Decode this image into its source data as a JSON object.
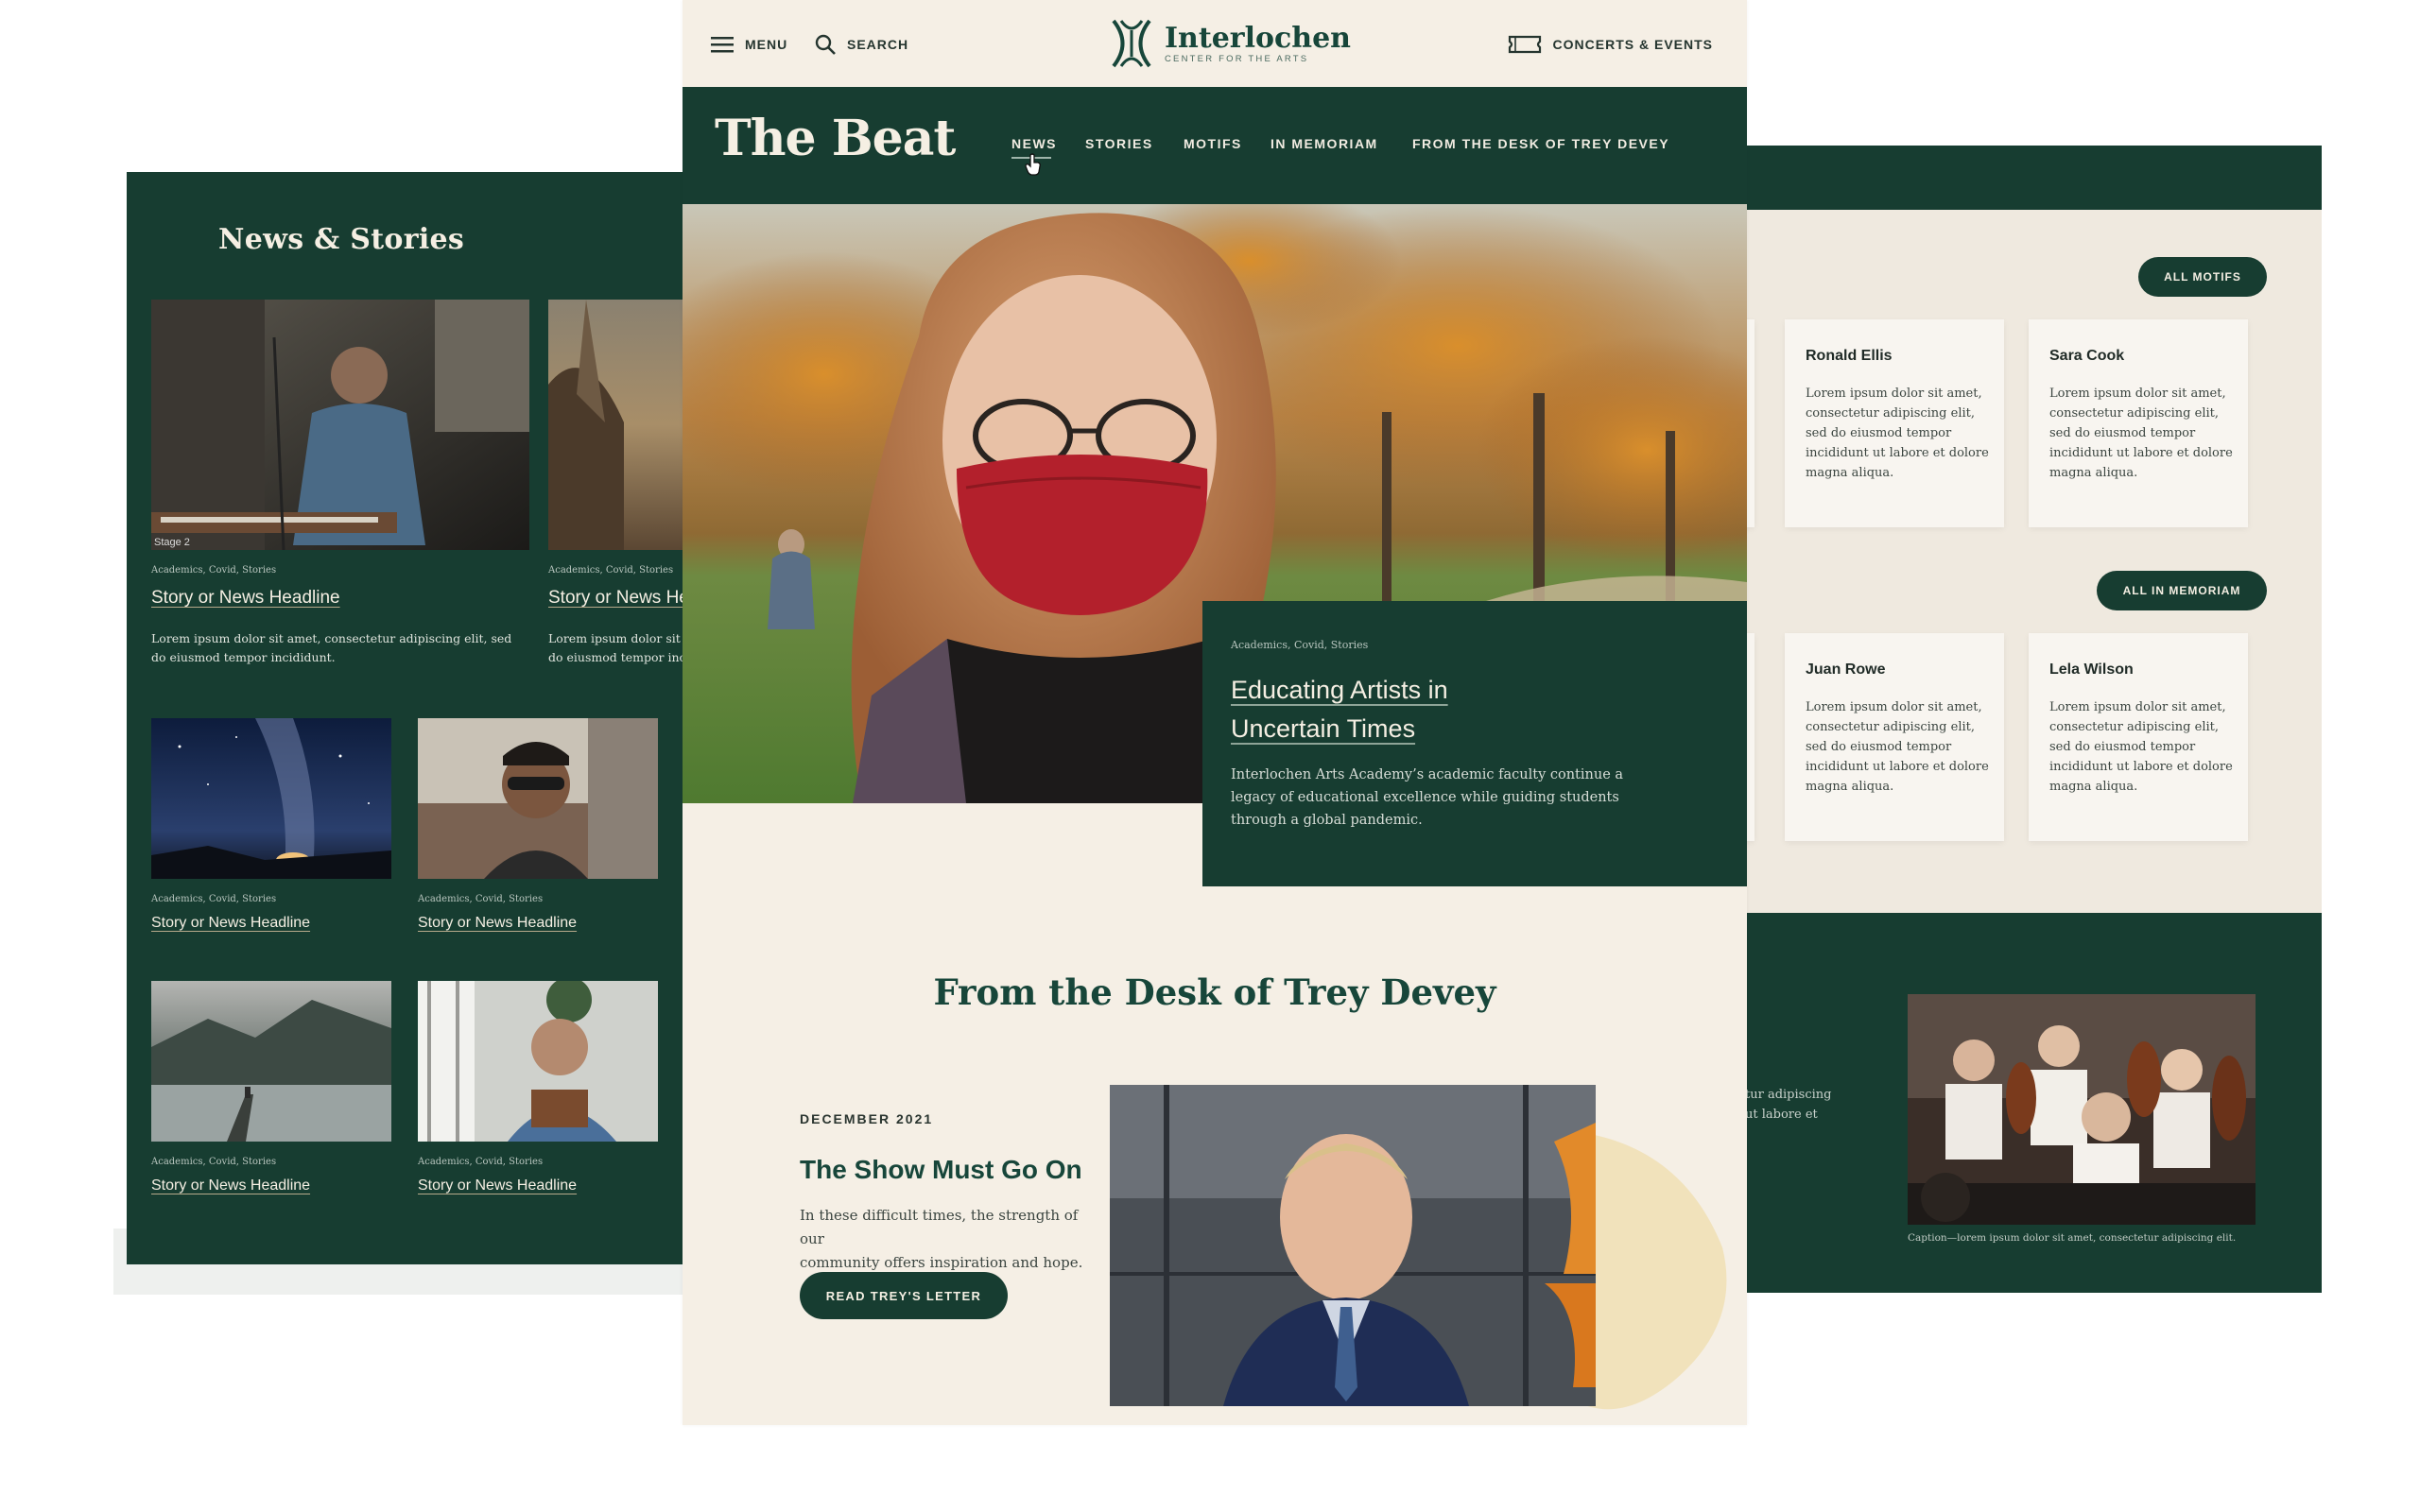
{
  "left_panel": {
    "title": "News & Stories",
    "top_stories": [
      {
        "tags": "Academics, Covid, Stories",
        "headline": "Story or News Headline",
        "excerpt_lines": [
          "Lorem ipsum dolor sit amet, consectetur adipiscing elit, sed",
          "do eiusmod tempor incididunt."
        ]
      },
      {
        "tags": "Academics, Covid, Stories",
        "headline": "Story or News Headline",
        "excerpt_lines": [
          "Lorem ipsum dolor sit amet, consectetur adipiscing elit, sed",
          "do eiusmod tempor incididunt."
        ]
      }
    ],
    "grid_stories": [
      {
        "tags": "Academics, Covid, Stories",
        "headline": "Story or News Headline"
      },
      {
        "tags": "Academics, Covid, Stories",
        "headline": "Story or News Headline"
      },
      {
        "tags": "Academics, Covid, Stories",
        "headline": "Story or News Headline"
      },
      {
        "tags": "Academics, Covid, Stories",
        "headline": "Story or News Headline"
      }
    ]
  },
  "header": {
    "menu_label": "MENU",
    "search_label": "SEARCH",
    "logo_name": "Interlochen",
    "logo_subtitle": "CENTER FOR THE ARTS",
    "events_label": "CONCERTS & EVENTS"
  },
  "nav": {
    "brand": "The Beat",
    "items": [
      {
        "label": "NEWS"
      },
      {
        "label": "STORIES"
      },
      {
        "label": "MOTIFS"
      },
      {
        "label": "IN MEMORIAM"
      },
      {
        "label": "FROM THE DESK OF TREY DEVEY"
      }
    ]
  },
  "hero": {
    "tags": "Academics, Covid, Stories",
    "headline_lines": [
      "Educating Artists in",
      "Uncertain Times"
    ],
    "excerpt_lines": [
      "Interlochen Arts Academy’s academic faculty continue a",
      "legacy of educational excellence while guiding students",
      "through a global pandemic."
    ]
  },
  "desk": {
    "title": "From the Desk of Trey Devey",
    "date": "DECEMBER 2021",
    "headline": "The Show Must Go On",
    "body_lines": [
      "In these difficult times, the strength of our",
      "community offers inspiration and hope."
    ],
    "button_label": "READ TREY'S LETTER"
  },
  "right_panel": {
    "motifs_button": "ALL MOTIFS",
    "memoriam_button": "ALL IN MEMORIAM",
    "motif_cards": [
      {
        "name": "Ronald Ellis",
        "body_lines": [
          "Lorem ipsum dolor sit amet,",
          "consectetur adipiscing elit,",
          "sed do eiusmod tempor",
          "incididunt ut labore et dolore",
          "magna aliqua."
        ]
      },
      {
        "name": "Sara Cook",
        "body_lines": [
          "Lorem ipsum dolor sit amet,",
          "consectetur adipiscing elit,",
          "sed do eiusmod tempor",
          "incididunt ut labore et dolore",
          "magna aliqua."
        ]
      }
    ],
    "memoriam_cards": [
      {
        "name": "Juan Rowe",
        "body_lines": [
          "Lorem ipsum dolor sit amet,",
          "consectetur adipiscing elit,",
          "sed do eiusmod tempor",
          "incididunt ut labore et dolore",
          "magna aliqua."
        ]
      },
      {
        "name": "Lela Wilson",
        "body_lines": [
          "Lorem ipsum dolor sit amet,",
          "consectetur adipiscing elit,",
          "sed do eiusmod tempor",
          "incididunt ut labore et dolore",
          "magna aliqua."
        ]
      }
    ],
    "partial_text_lines": [
      "tur adipiscing",
      "ut labore et"
    ],
    "caption": "Caption—lorem ipsum dolor sit amet, consectetur adipiscing elit."
  },
  "colors": {
    "brand_green": "#173d31",
    "cream": "#f5efe5",
    "right_bg": "#efe9df"
  }
}
